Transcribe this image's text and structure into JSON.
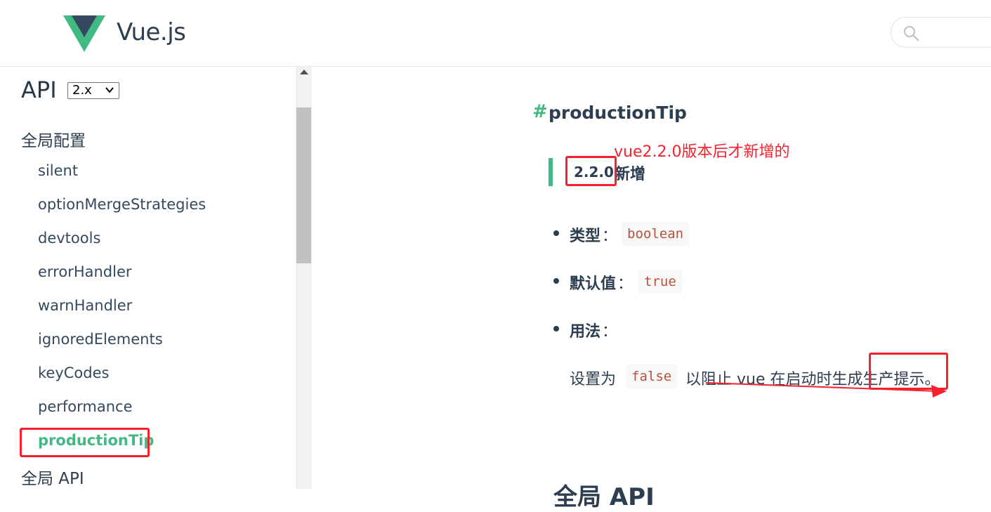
{
  "header": {
    "brand": "Vue.js",
    "search_placeholder": ""
  },
  "sidebar": {
    "title": "API",
    "version": "2.x",
    "section_global_config": "全局配置",
    "items": [
      {
        "label": "silent"
      },
      {
        "label": "optionMergeStrategies"
      },
      {
        "label": "devtools"
      },
      {
        "label": "errorHandler"
      },
      {
        "label": "warnHandler"
      },
      {
        "label": "ignoredElements"
      },
      {
        "label": "keyCodes"
      },
      {
        "label": "performance"
      },
      {
        "label": "productionTip",
        "active": true
      }
    ],
    "section_global_api": "全局 API"
  },
  "content": {
    "hash": "#",
    "title": "productionTip",
    "annotation": "vue2.2.0版本后才新增的",
    "tip_version": "2.2.0",
    "tip_new": "新增",
    "type_label": "类型",
    "type_value": "boolean",
    "default_label": "默认值",
    "default_value": "true",
    "usage_label": "用法",
    "colon": "：",
    "usage_prefix": "设置为",
    "usage_code": "false",
    "usage_suffix": "以阻止 vue 在启动时生成生产提示。",
    "next_heading": "全局 API"
  },
  "colors": {
    "accent": "#42b983",
    "annotation": "#f5222d",
    "code": "#b5533c"
  }
}
